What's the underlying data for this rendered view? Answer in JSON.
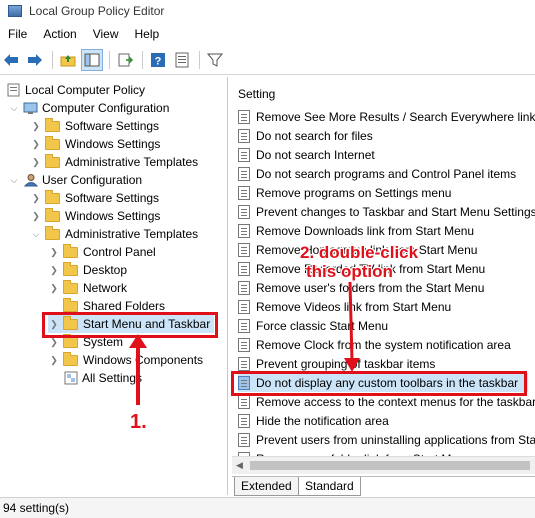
{
  "window": {
    "title": "Local Group Policy Editor"
  },
  "menu": [
    "File",
    "Action",
    "View",
    "Help"
  ],
  "toolbar_icons": [
    "back-arrow-icon",
    "forward-arrow-icon",
    "up-folder-icon",
    "show-hide-tree-icon",
    "export-list-icon",
    "help-icon",
    "properties-icon",
    "filter-icon"
  ],
  "tree": {
    "root": "Local Computer Policy",
    "computer_config": "Computer Configuration",
    "cc_software": "Software Settings",
    "cc_windows": "Windows Settings",
    "cc_admin": "Administrative Templates",
    "user_config": "User Configuration",
    "uc_software": "Software Settings",
    "uc_windows": "Windows Settings",
    "uc_admin": "Administrative Templates",
    "control_panel": "Control Panel",
    "desktop": "Desktop",
    "network": "Network",
    "shared_folders": "Shared Folders",
    "start_menu": "Start Menu and Taskbar",
    "system": "System",
    "windows_components": "Windows Components",
    "all_settings": "All Settings"
  },
  "settings": {
    "header": "Setting",
    "items": [
      "Remove See More Results / Search Everywhere link",
      "Do not search for files",
      "Do not search Internet",
      "Do not search programs and Control Panel items",
      "Remove programs on Settings menu",
      "Prevent changes to Taskbar and Start Menu Settings",
      "Remove Downloads link from Start Menu",
      "Remove Homegroup link from Start Menu",
      "Remove Recorded TV link from Start Menu",
      "Remove user's folders from the Start Menu",
      "Remove Videos link from Start Menu",
      "Force classic Start Menu",
      "Remove Clock from the system notification area",
      "Prevent grouping of taskbar items",
      "Do not display any custom toolbars in the taskbar",
      "Remove access to the context menus for the taskbar",
      "Hide the notification area",
      "Prevent users from uninstalling applications from Start",
      "Remove user folder link from Start Menu"
    ]
  },
  "tabs": [
    "Extended",
    "Standard"
  ],
  "status": "94 setting(s)",
  "annotations": {
    "step1": "1.",
    "step2_line1": "2. double-click",
    "step2_line2": "this option"
  },
  "colors": {
    "annotation_red": "#e0101a",
    "selection_blue": "#cce4f7"
  }
}
